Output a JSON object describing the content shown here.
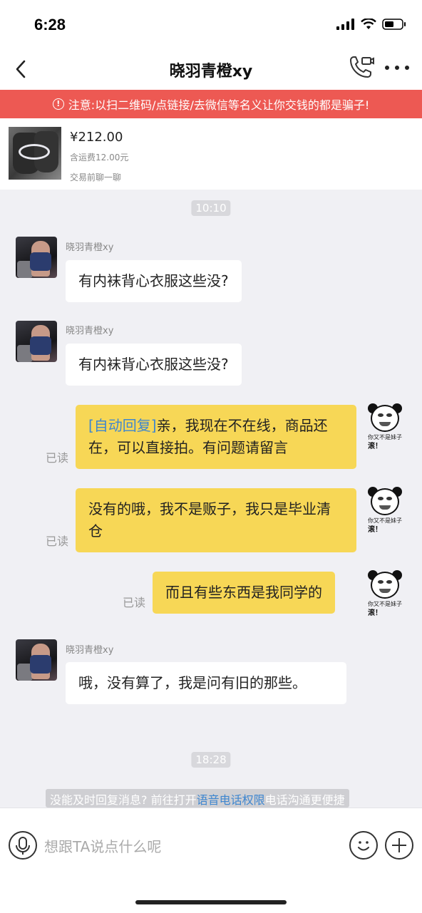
{
  "status_bar": {
    "time": "6:28"
  },
  "header": {
    "title": "晓羽青橙xy"
  },
  "warning": {
    "icon": "!",
    "text": "注意:以扫二维码/点链接/去微信等名义让你交钱的都是骗子!"
  },
  "product": {
    "price": "¥212.00",
    "shipping": "含运费12.00元",
    "hint": "交易前聊一聊"
  },
  "timestamps": [
    "10:10",
    "18:28"
  ],
  "messages": [
    {
      "sender": "晓羽青橙xy",
      "text": "有内袜背心衣服这些没?"
    },
    {
      "sender": "晓羽青橙xy",
      "text": "有内袜背心衣服这些没?"
    },
    {
      "tag": "[自动回复]",
      "text": "亲，我现在不在线，商品还在，可以直接拍。有问题请留言",
      "read": "已读"
    },
    {
      "text": "没有的哦，我不是贩子，我只是毕业清仓",
      "read": "已读"
    },
    {
      "text": "而且有些东西是我同学的",
      "read": "已读"
    },
    {
      "sender": "晓羽青橙xy",
      "text": "哦，没有算了，我是问有旧的那些。"
    }
  ],
  "sticker": {
    "caption": "你又不是妹子",
    "caption2": "滚！"
  },
  "notice": {
    "before": "没能及时回复消息? 前往打开",
    "link": "语音电话权限",
    "after": "电话沟通更便捷"
  },
  "input": {
    "placeholder": "想跟TA说点什么呢"
  }
}
